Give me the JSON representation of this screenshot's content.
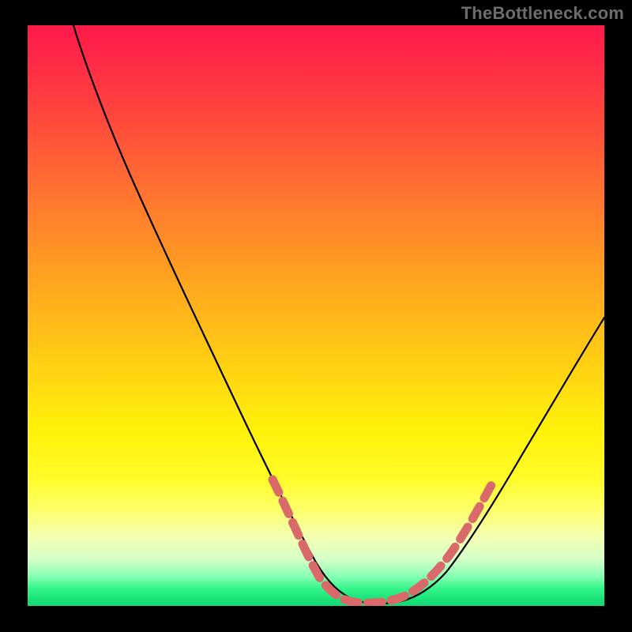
{
  "attribution": "TheBottleneck.com",
  "colors": {
    "background": "#000000",
    "attribution_text": "#6d6d6d",
    "curve_stroke": "#000000",
    "dot_stroke": "#da6a6a",
    "gradient_stops": [
      {
        "pct": 0,
        "hex": "#ff1a4a"
      },
      {
        "pct": 6,
        "hex": "#ff2946"
      },
      {
        "pct": 17,
        "hex": "#ff4b3b"
      },
      {
        "pct": 31,
        "hex": "#ff7a2e"
      },
      {
        "pct": 44,
        "hex": "#ffa41f"
      },
      {
        "pct": 58,
        "hex": "#ffcf13"
      },
      {
        "pct": 70,
        "hex": "#fff20a"
      },
      {
        "pct": 78,
        "hex": "#fffb28"
      },
      {
        "pct": 83,
        "hex": "#feff63"
      },
      {
        "pct": 88,
        "hex": "#f4ffb0"
      },
      {
        "pct": 92,
        "hex": "#d4ffc8"
      },
      {
        "pct": 95,
        "hex": "#84ffb3"
      },
      {
        "pct": 97,
        "hex": "#35f58a"
      },
      {
        "pct": 99,
        "hex": "#17e077"
      },
      {
        "pct": 100,
        "hex": "#15d973"
      }
    ]
  },
  "chart_data": {
    "type": "line",
    "title": "",
    "xlabel": "",
    "ylabel": "",
    "xlim": [
      0,
      100
    ],
    "ylim": [
      0,
      100
    ],
    "series": [
      {
        "name": "bottleneck-curve",
        "points": [
          {
            "x": 8,
            "y": 100
          },
          {
            "x": 10,
            "y": 95
          },
          {
            "x": 14,
            "y": 86
          },
          {
            "x": 20,
            "y": 72
          },
          {
            "x": 26,
            "y": 58
          },
          {
            "x": 32,
            "y": 44
          },
          {
            "x": 38,
            "y": 30
          },
          {
            "x": 44,
            "y": 16
          },
          {
            "x": 48,
            "y": 8
          },
          {
            "x": 52,
            "y": 3
          },
          {
            "x": 56,
            "y": 1
          },
          {
            "x": 60,
            "y": 0.5
          },
          {
            "x": 64,
            "y": 1
          },
          {
            "x": 68,
            "y": 3
          },
          {
            "x": 72,
            "y": 7
          },
          {
            "x": 78,
            "y": 15
          },
          {
            "x": 84,
            "y": 26
          },
          {
            "x": 90,
            "y": 38
          },
          {
            "x": 96,
            "y": 50
          },
          {
            "x": 100,
            "y": 58
          }
        ]
      },
      {
        "name": "optimal-range-dots",
        "points": [
          {
            "x": 44,
            "y": 16
          },
          {
            "x": 48,
            "y": 8
          },
          {
            "x": 52,
            "y": 3
          },
          {
            "x": 56,
            "y": 1
          },
          {
            "x": 60,
            "y": 0.5
          },
          {
            "x": 64,
            "y": 1
          },
          {
            "x": 68,
            "y": 3
          },
          {
            "x": 72,
            "y": 7
          },
          {
            "x": 78,
            "y": 15
          }
        ]
      }
    ]
  }
}
